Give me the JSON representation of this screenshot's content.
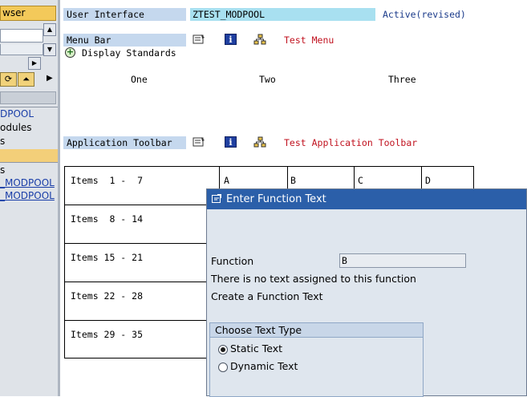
{
  "nav": {
    "browser_tab": "wser",
    "toolbar_arrow": "▶",
    "items": [
      {
        "label": "DPOOL",
        "style": "blue"
      },
      {
        "label": "odules",
        "style": "plain"
      },
      {
        "label": "s",
        "style": "plain"
      },
      {
        "label": "s",
        "style": "plain"
      },
      {
        "label": "_MODPOOL",
        "style": "blue-underline"
      },
      {
        "label": "_MODPOOL",
        "style": "blue-underline"
      }
    ]
  },
  "header": {
    "user_interface_label": "User Interface",
    "program_name": "ZTEST_MODPOOL",
    "status": "Active(revised)"
  },
  "menu_bar": {
    "label": "Menu Bar",
    "title": "Test Menu",
    "display_standards": "Display Standards",
    "menus": [
      "One",
      "Two",
      "Three"
    ]
  },
  "app_toolbar": {
    "label": "Application Toolbar",
    "title": "Test Application Toolbar",
    "rows": [
      "Items  1 -  7",
      "Items  8 - 14",
      "Items 15 - 21",
      "Items 22 - 28",
      "Items 29 - 35"
    ],
    "columns": [
      "A",
      "B",
      "C",
      "D"
    ]
  },
  "dialog": {
    "title": "Enter Function Text",
    "function_label": "Function",
    "function_value": "B",
    "info_line": "There is no text assigned to this function",
    "create_line": "Create a Function Text",
    "group_title": "Choose Text Type",
    "options": [
      {
        "label": "Static Text",
        "selected": true
      },
      {
        "label": "Dynamic Text",
        "selected": false
      }
    ]
  },
  "colors": {
    "label_blue": "#c5d8ee",
    "field_cyan": "#a8e0f0",
    "title_red": "#c1121f",
    "dialog_title": "#2b5fa9"
  }
}
